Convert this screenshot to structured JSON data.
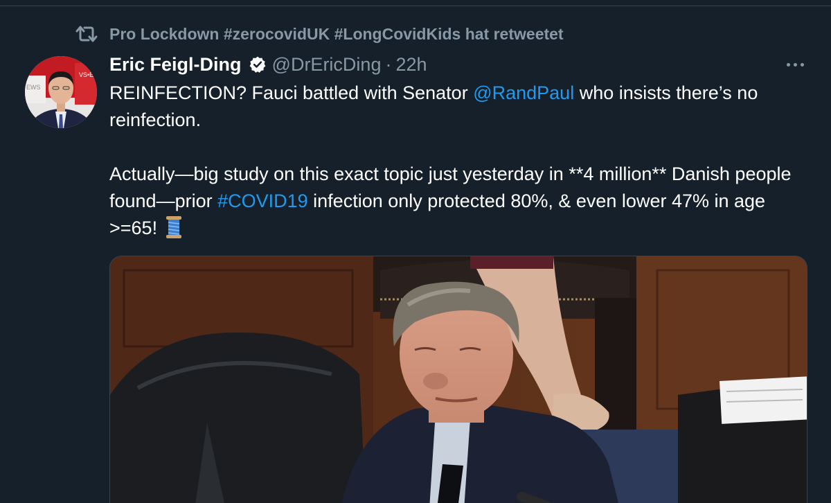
{
  "retweet": {
    "icon": "retweet-icon",
    "text": "Pro Lockdown #zerocovidUK #LongCovidKids hat retweetet"
  },
  "author": {
    "name": "Eric Feigl-Ding",
    "verified_icon": "verified-badge-icon",
    "handle": "@DrEricDing",
    "separator": "·",
    "timestamp": "22h"
  },
  "tweet": {
    "line1_a": "REINFECTION? Fauci battled with Senator ",
    "mention": "@RandPaul",
    "line1_b": " who insists there’s no reinfection.",
    "para2_a": "Actually—big study on this exact topic just yesterday in **4 million** Danish people found—prior ",
    "hashtag": "#COVID19",
    "para2_b": " infection only protected 80%, & even lower 47% in age >=65! ",
    "emoji_icon": "thread-spool-icon"
  },
  "media": {
    "type": "video-still",
    "subject": "senator-speaking-at-hearing"
  },
  "colors": {
    "background": "#15202b",
    "text": "#ffffff",
    "secondary": "#8899a6",
    "link": "#1d9bf0",
    "divider": "#38444d"
  }
}
